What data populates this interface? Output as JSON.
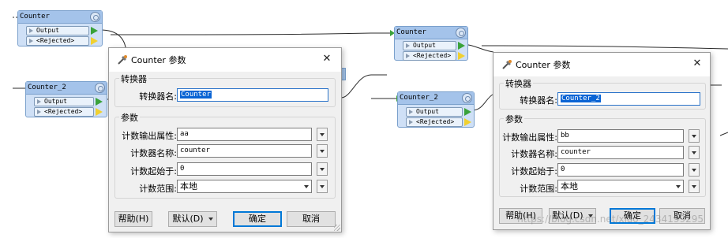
{
  "canvas": {
    "nodes": [
      {
        "title": "Counter",
        "ports": [
          "Output",
          "<Rejected>"
        ]
      },
      {
        "title": "Counter_2",
        "ports": [
          "Output",
          "<Rejected>"
        ]
      },
      {
        "title": "Counter",
        "ports": [
          "Output",
          "<Rejected>"
        ]
      },
      {
        "title": "Counter_2",
        "ports": [
          "Output",
          "<Rejected>"
        ]
      }
    ]
  },
  "dialogs": [
    {
      "title": "Counter 参数",
      "group_transformer": "转换器",
      "transformer_name_label": "转换器名:",
      "transformer_name_value": "Counter",
      "group_params": "参数",
      "output_attr_label": "计数输出属性:",
      "output_attr_value": "aa",
      "counter_name_label": "计数器名称:",
      "counter_name_value": "counter",
      "start_label": "计数起始于:",
      "start_value": "0",
      "scope_label": "计数范围:",
      "scope_value": "本地",
      "help_label": "帮助(H)",
      "defaults_label": "默认(D)",
      "ok_label": "确定",
      "cancel_label": "取消"
    },
    {
      "title": "Counter 参数",
      "group_transformer": "转换器",
      "transformer_name_label": "转换器名:",
      "transformer_name_value": "Counter_2",
      "group_params": "参数",
      "output_attr_label": "计数输出属性:",
      "output_attr_value": "bb",
      "counter_name_label": "计数器名称:",
      "counter_name_value": "counter",
      "start_label": "计数起始于:",
      "start_value": "0",
      "scope_label": "计数范围:",
      "scope_value": "本地",
      "help_label": "帮助(H)",
      "defaults_label": "默认(D)",
      "ok_label": "确定",
      "cancel_label": "取消"
    }
  ],
  "watermark": "https://blog.csdn.net/xiao_2434199295"
}
